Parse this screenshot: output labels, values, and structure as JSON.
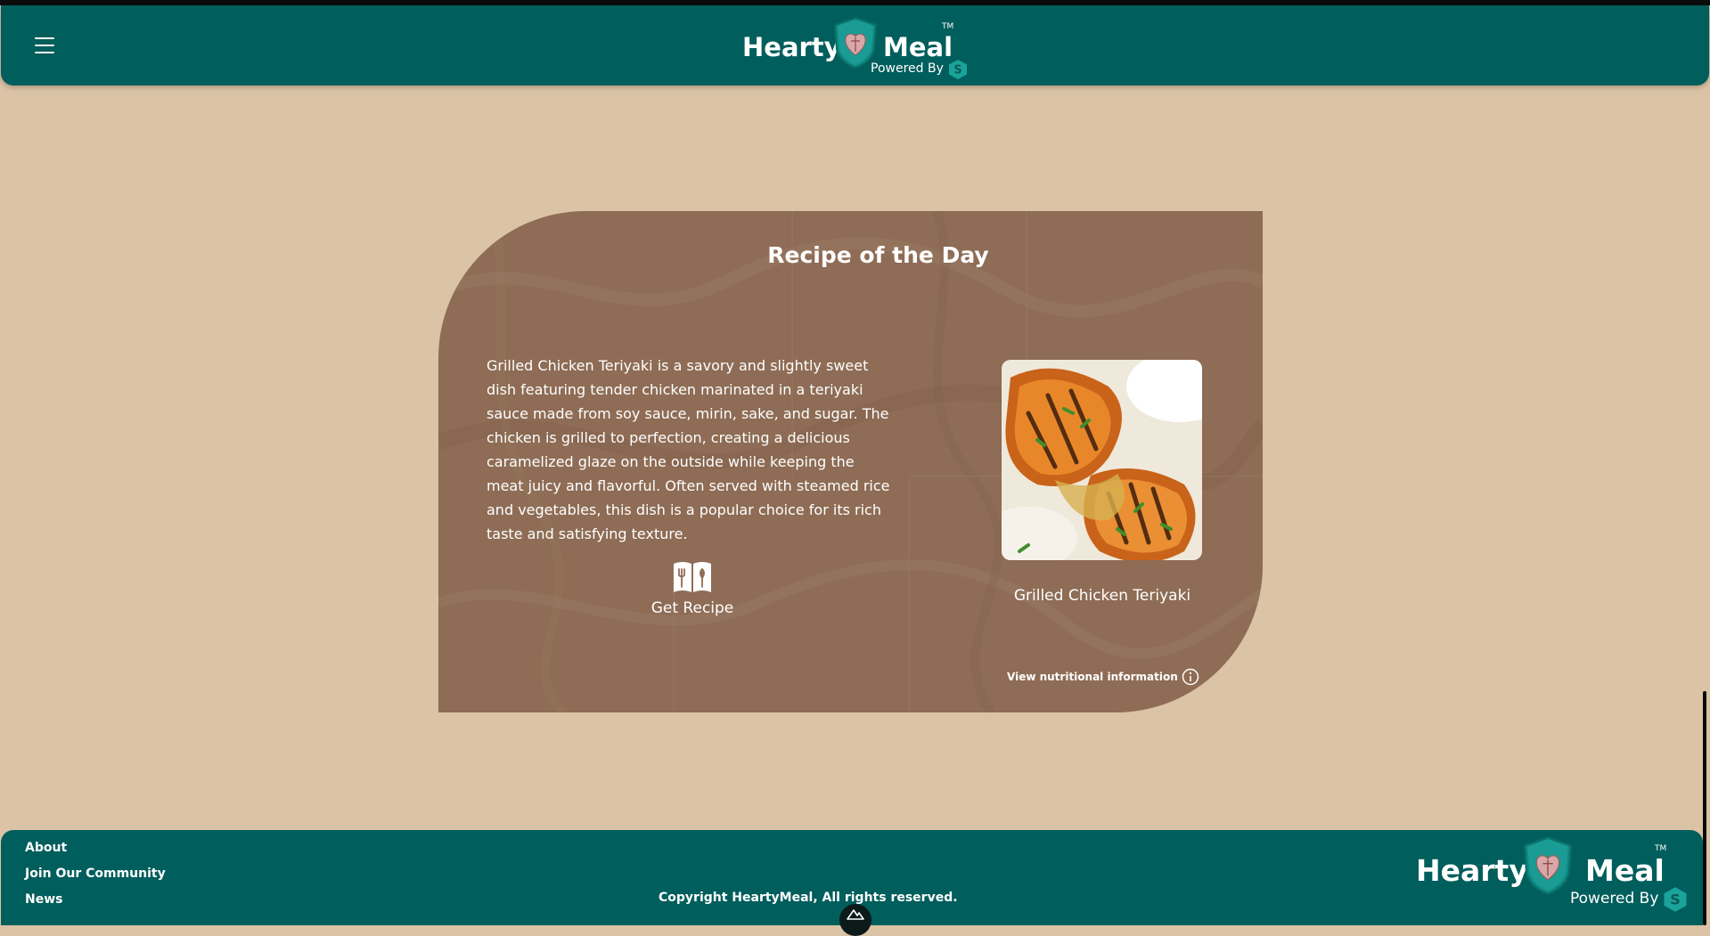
{
  "header": {
    "menu_icon": "hamburger-menu-icon",
    "brand": {
      "word1": "Hearty",
      "word2": "Meal",
      "trademark": "TM",
      "powered_by": "Powered By",
      "logo_icon": "heart-shield-icon",
      "badge_icon": "s-hexagon-icon"
    }
  },
  "recipe_card": {
    "title": "Recipe of the Day",
    "description": "Grilled Chicken Teriyaki is a savory and slightly sweet dish featuring tender chicken marinated in a teriyaki sauce made from soy sauce, mirin, sake, and sugar. The chicken is grilled to perfection, creating a delicious caramelized glaze on the outside while keeping the meat juicy and flavorful. Often served with steamed rice and vegetables, this dish is a popular choice for its rich taste and satisfying texture.",
    "get_recipe_label": "Get Recipe",
    "get_recipe_icon": "recipe-book-icon",
    "dish_name": "Grilled Chicken Teriyaki",
    "dish_image_alt": "Grilled Chicken Teriyaki",
    "nutrition_link": "View nutritional information",
    "nutrition_icon": "info-icon"
  },
  "footer": {
    "links": [
      "About",
      "Join Our Community",
      "News"
    ],
    "copyright": "Copyright HeartyMeal, All rights reserved.",
    "badge_icon": "nuxt-mountain-icon",
    "brand": {
      "word1": "Hearty",
      "word2": "Meal",
      "trademark": "TM",
      "powered_by": "Powered By"
    }
  },
  "colors": {
    "page_background": "#dbc3a6",
    "header_background": "#005e5c",
    "card_background": "#8e6c55",
    "badge_teal": "#1aa39a"
  }
}
